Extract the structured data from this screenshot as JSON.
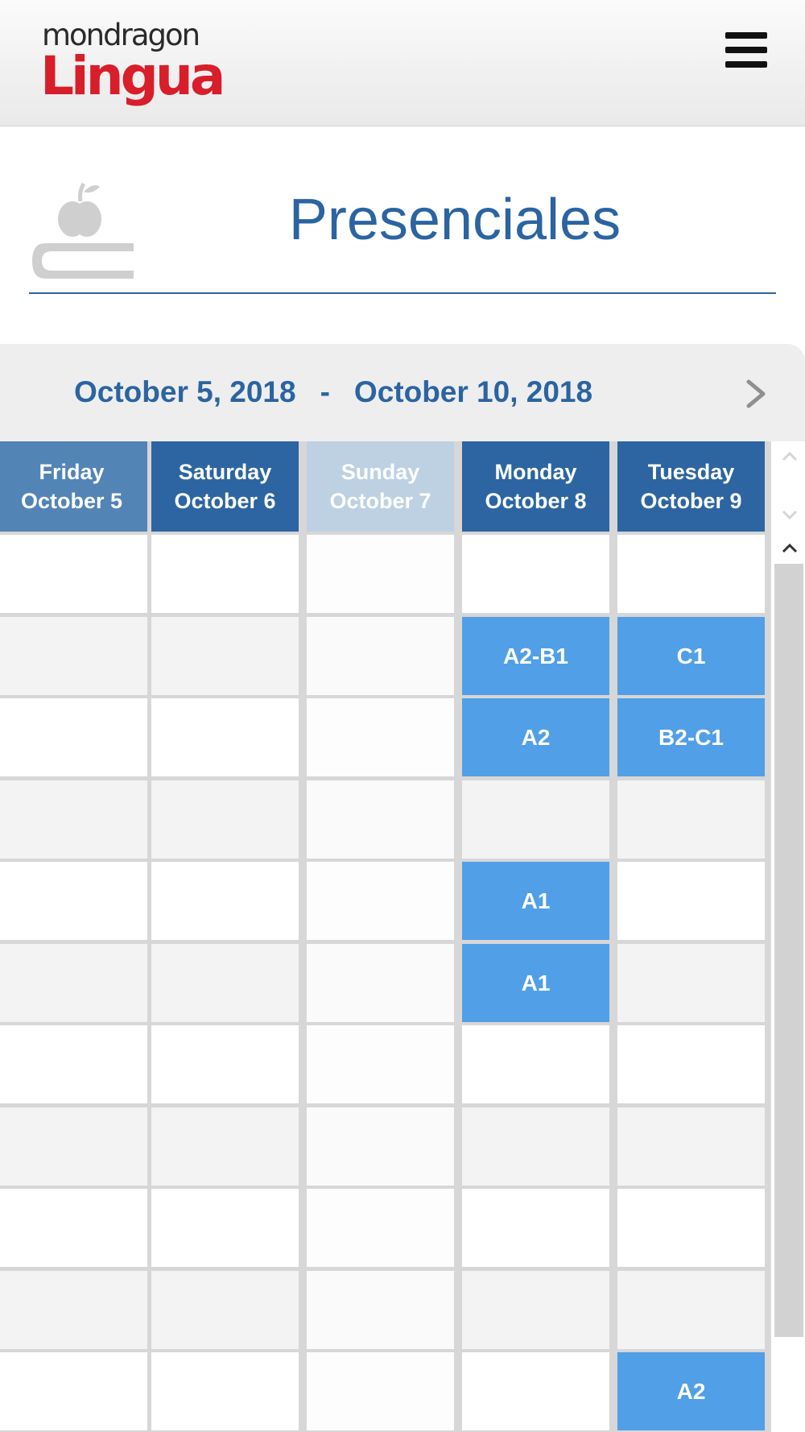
{
  "brand": {
    "logo_line1": "mondragon",
    "logo_line2": "Lingua",
    "logo_red": "#d81e2a"
  },
  "header": {
    "menu_icon": "hamburger-menu-icon"
  },
  "page": {
    "title": "Presenciales",
    "title_icon": "apple-on-book-icon",
    "accent_color": "#2b64a1"
  },
  "calendar": {
    "range_start": "October 5, 2018",
    "range_separator": "-",
    "range_end": "October 10, 2018",
    "next_icon": "chevron-right-icon",
    "days": [
      {
        "weekday": "Friday",
        "date": "October 5",
        "state": "past"
      },
      {
        "weekday": "Saturday",
        "date": "October 6",
        "state": "current"
      },
      {
        "weekday": "Sunday",
        "date": "October 7",
        "state": "closed"
      },
      {
        "weekday": "Monday",
        "date": "October 8",
        "state": "current"
      },
      {
        "weekday": "Tuesday",
        "date": "October 9",
        "state": "current"
      }
    ],
    "row_count": 11,
    "events": [
      {
        "day": 3,
        "row": 1,
        "label": "A2-B1"
      },
      {
        "day": 4,
        "row": 1,
        "label": "C1"
      },
      {
        "day": 3,
        "row": 2,
        "label": "A2"
      },
      {
        "day": 4,
        "row": 2,
        "label": "B2-C1"
      },
      {
        "day": 3,
        "row": 4,
        "label": "A1"
      },
      {
        "day": 3,
        "row": 5,
        "label": "A1"
      },
      {
        "day": 4,
        "row": 10,
        "label": "A2"
      }
    ],
    "event_color": "#519fe6"
  }
}
